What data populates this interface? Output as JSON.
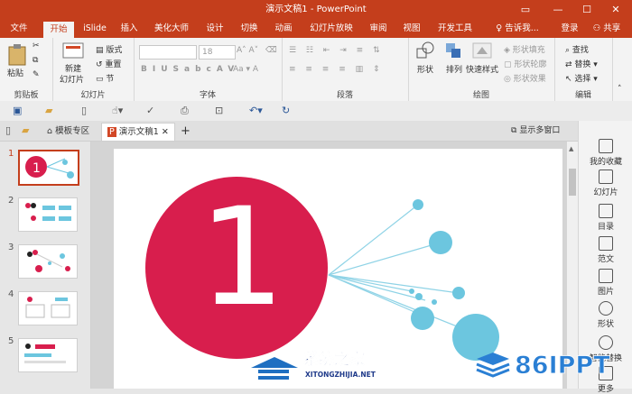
{
  "titlebar": {
    "title": "演示文稿1 - PowerPoint",
    "bg": "#c43e1c"
  },
  "tabs": [
    "文件",
    "开始",
    "iSlide",
    "插入",
    "美化大师",
    "设计",
    "切换",
    "动画",
    "幻灯片放映",
    "审阅",
    "视图",
    "开发工具"
  ],
  "active_tab": "开始",
  "tell_me": "告诉我...",
  "login": "登录",
  "share": "共享",
  "ribbon": {
    "clipboard": {
      "paste": "粘贴",
      "label": "剪贴板"
    },
    "slides": {
      "new_slide_l1": "新建",
      "new_slide_l2": "幻灯片",
      "layout": "版式",
      "reset": "重置",
      "section": "节",
      "label": "幻灯片"
    },
    "font": {
      "size": "18",
      "label": "字体"
    },
    "paragraph": {
      "label": "段落"
    },
    "drawing": {
      "shape": "形状",
      "arrange": "排列",
      "quick_styles": "快速样式",
      "fill": "形状填充",
      "outline": "形状轮廓",
      "effects": "形状效果",
      "label": "绘图"
    },
    "editing": {
      "find": "查找",
      "replace": "替换",
      "select": "选择",
      "label": "编辑"
    }
  },
  "doctabs": {
    "template_zone": "模板专区",
    "document": "演示文稿1",
    "multi_window": "显示多窗口"
  },
  "thumbnails": [
    "1",
    "2",
    "3",
    "4",
    "5"
  ],
  "slide": {
    "big_number": "1",
    "accent": "#d81e4d",
    "bubble": "#6cc6df"
  },
  "right_panel": [
    "我的收藏",
    "幻灯片",
    "目录",
    "范文",
    "图片",
    "形状",
    "智能替换",
    "更多"
  ],
  "watermarks": {
    "left_main": "系统之家",
    "left_sub": "XITONGZHIJIA.NET",
    "right": "86IPPT"
  }
}
